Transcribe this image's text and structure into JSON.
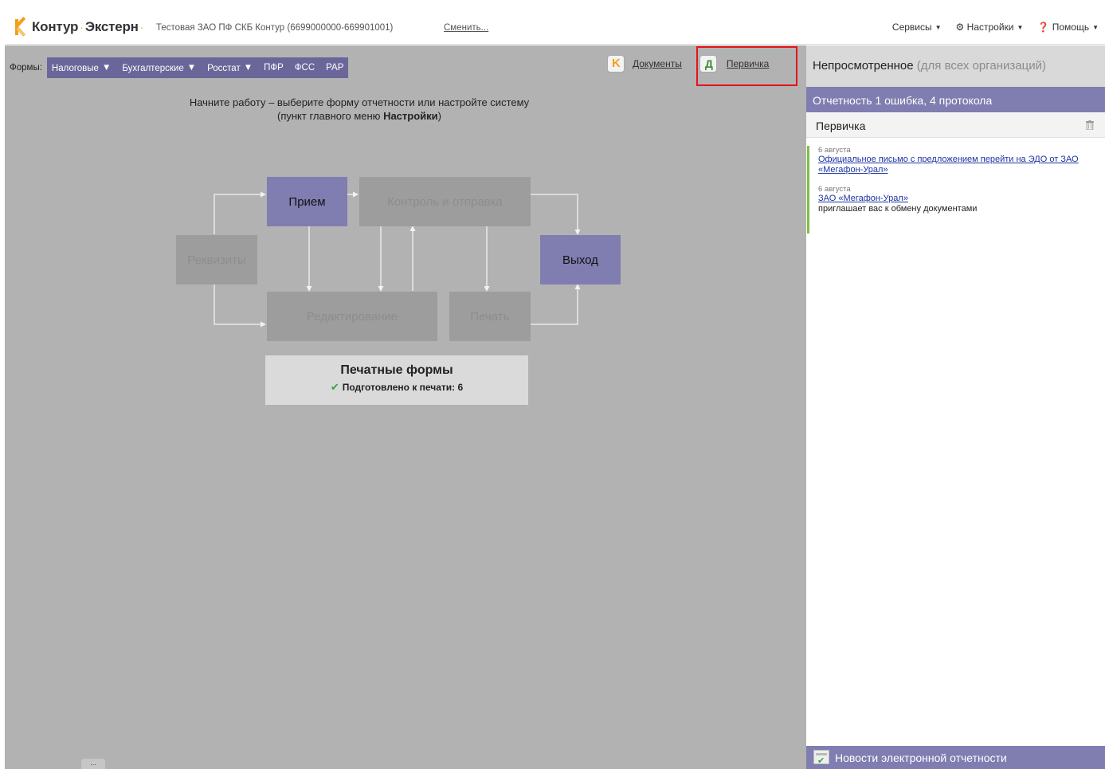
{
  "header": {
    "logo_part1": "Контур",
    "logo_part2": "Экстерн",
    "org_name": "Тестовая ЗАО ПФ СКБ Контур (6699000000-669901001)",
    "org_switch": "Сменить...",
    "menu": {
      "services": "Сервисы",
      "settings": "Настройки",
      "help": "Помощь"
    }
  },
  "forms": {
    "label": "Формы:",
    "items": [
      "Налоговые",
      "Бухгалтерские",
      "Росстат",
      "ПФР",
      "ФСС",
      "РАР"
    ]
  },
  "links": {
    "documents": "Документы",
    "primary": "Первичка"
  },
  "intro": {
    "line1": "Начните работу – выберите форму отчетности или настройте систему",
    "line2_prefix": "(пункт главного меню",
    "line2_bold": "Настройки",
    "line2_suffix": ")"
  },
  "diagram": {
    "requisites": "Реквизиты",
    "reception": "Прием",
    "control": "Контроль и отправка",
    "editing": "Редактирование",
    "print": "Печать",
    "exit": "Выход"
  },
  "print_forms": {
    "title": "Печатные формы",
    "status": "Подготовлено к печати: 6"
  },
  "bottom_tab": "...",
  "right_panel": {
    "title": "Непросмотренное",
    "title_muted": "(для всех организаций)",
    "reporting": "Отчетность 1 ошибка, 4 протокола",
    "section": "Первичка",
    "messages": [
      {
        "date": "6 августа",
        "link": "Официальное письмо с предложением перейти на ЭДО от ЗАО «Мегафон-Урал»",
        "text": ""
      },
      {
        "date": "6 августа",
        "link": "ЗАО «Мегафон-Урал»",
        "text": "приглашает вас к обмену документами"
      }
    ],
    "news": "Новости электронной отчетности"
  },
  "colors": {
    "accent_purple": "#807db1",
    "forms_bar": "#6a6699",
    "logo_orange": "#f2a019",
    "highlight_red": "#e3151a",
    "unread_green": "#7ac143"
  }
}
